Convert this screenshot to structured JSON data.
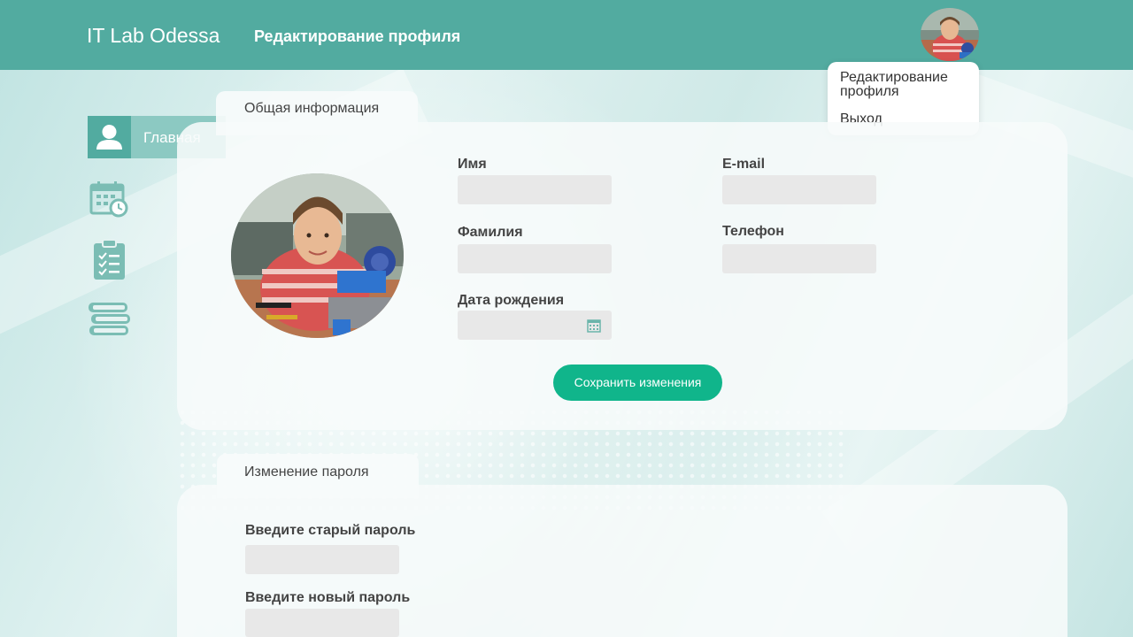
{
  "header": {
    "brand": "IT Lab Odessa",
    "title": "Редактирование профиля",
    "background_color": "#52aba0"
  },
  "user_menu": {
    "items": [
      {
        "label": "Редактирование профиля"
      },
      {
        "label": "Выход"
      }
    ]
  },
  "sidebar": {
    "items": [
      {
        "label": "Главная",
        "icon": "user-icon",
        "active": true
      },
      {
        "label": "",
        "icon": "calendar-clock-icon"
      },
      {
        "label": "",
        "icon": "checklist-icon"
      },
      {
        "label": "",
        "icon": "books-icon"
      }
    ],
    "accent_color": "#52aba0"
  },
  "general_info": {
    "tab_label": "Общая информация",
    "fields": {
      "first_name": {
        "label": "Имя",
        "value": ""
      },
      "last_name": {
        "label": "Фамилия",
        "value": ""
      },
      "birth_date": {
        "label": "Дата рождения",
        "value": ""
      },
      "email": {
        "label": "E-mail",
        "value": ""
      },
      "phone": {
        "label": "Телефон",
        "value": ""
      }
    },
    "save_button": "Сохранить изменения",
    "save_button_color": "#10b58b"
  },
  "password_change": {
    "tab_label": "Изменение пароля",
    "fields": {
      "old_password": {
        "label": "Введите старый пароль",
        "value": ""
      },
      "new_password": {
        "label": "Введите новый пароль",
        "value": ""
      }
    }
  }
}
